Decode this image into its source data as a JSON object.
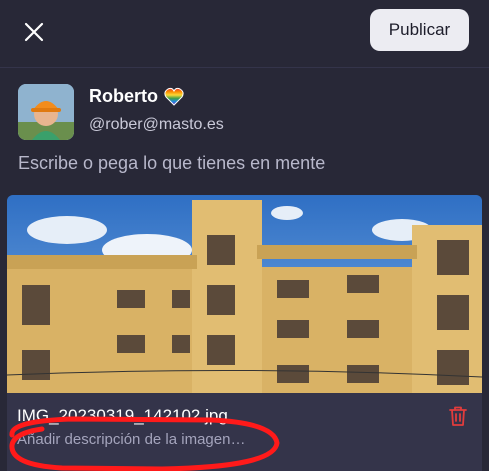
{
  "header": {
    "close_icon": "close-icon",
    "publish_label": "Publicar"
  },
  "author": {
    "display_name": "Roberto",
    "badge_icon": "rainbow-heart-icon",
    "handle": "@rober@masto.es"
  },
  "compose": {
    "placeholder": "Escribe o pega lo que tienes en mente"
  },
  "attachment": {
    "filename": "IMG_20230319_142102.jpg",
    "alt_text_prompt": "Añadir descripción de la imagen…",
    "delete_icon": "trash-icon"
  },
  "colors": {
    "background": "#282837",
    "card": "#34344a",
    "button_bg": "#ececf2",
    "delete": "#e23c3c",
    "annotation": "#ff1a1a"
  }
}
